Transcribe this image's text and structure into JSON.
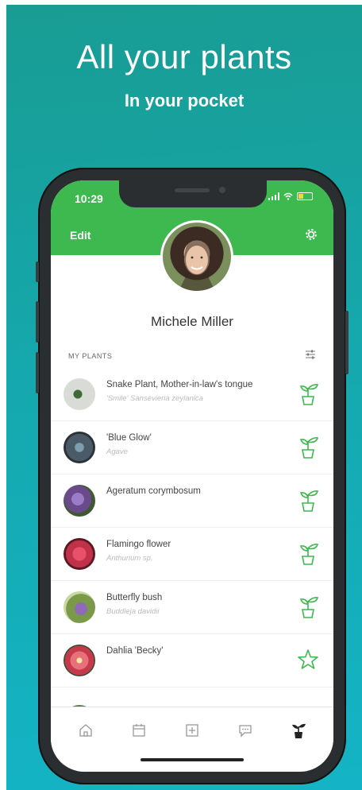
{
  "promo": {
    "headline": "All your plants",
    "subheadline": "In your pocket"
  },
  "status_bar": {
    "time": "10:29"
  },
  "header": {
    "edit_label": "Edit",
    "settings_icon": "gear-icon"
  },
  "profile": {
    "name": "Michele Miller"
  },
  "section": {
    "label": "MY PLANTS",
    "filter_icon": "filter-sliders-icon"
  },
  "plants": [
    {
      "name": "Snake Plant, Mother-in-law's tongue",
      "scientific": "'Smile' Sansevieria zeylanica",
      "icon": "potted-plant-icon",
      "thumb_color": "#d9dcd6"
    },
    {
      "name": "'Blue Glow'",
      "scientific": "Agave",
      "icon": "potted-plant-icon",
      "thumb_color": "#4a5a66"
    },
    {
      "name": "Ageratum corymbosum",
      "scientific": "",
      "icon": "potted-plant-icon",
      "thumb_color": "#6a4a8a"
    },
    {
      "name": "Flamingo flower",
      "scientific": "Anthurium sp.",
      "icon": "potted-plant-icon",
      "thumb_color": "#c2314a"
    },
    {
      "name": "Butterfly bush",
      "scientific": "Buddleja davidii",
      "icon": "potted-plant-icon",
      "thumb_color": "#7c6aa0"
    },
    {
      "name": "Dahlia 'Becky'",
      "scientific": "",
      "icon": "star-icon",
      "thumb_color": "#c53a4a"
    }
  ],
  "tabs": [
    {
      "name": "home-icon"
    },
    {
      "name": "calendar-icon"
    },
    {
      "name": "add-icon"
    },
    {
      "name": "chat-icon"
    },
    {
      "name": "plant-icon"
    }
  ],
  "colors": {
    "accent_green": "#3db94f",
    "background_teal": "#15a8ad"
  }
}
